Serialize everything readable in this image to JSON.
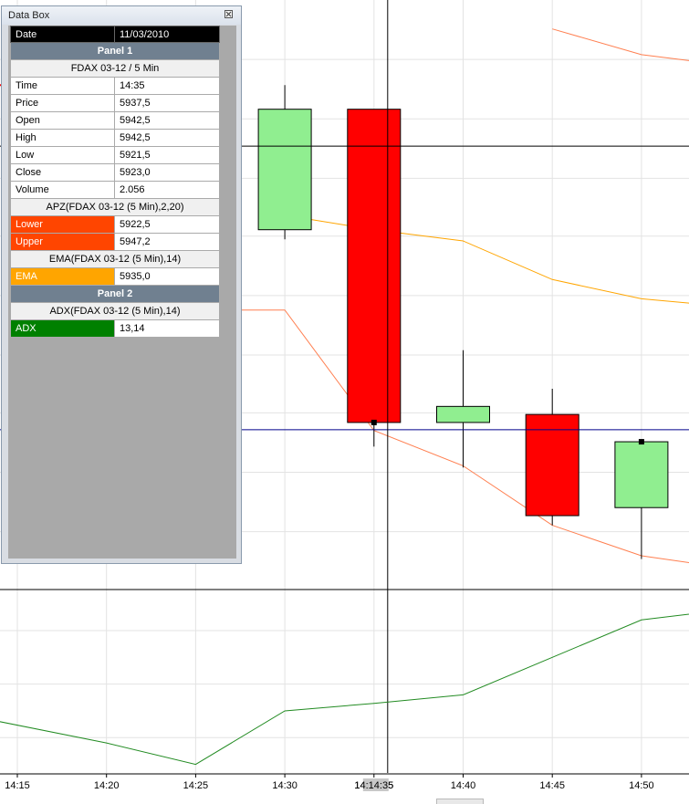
{
  "databox": {
    "title": "Data Box",
    "date_label": "Date",
    "date_value": "11/03/2010",
    "panel1_title": "Panel 1",
    "instrument": "FDAX 03-12 / 5 Min",
    "rows": [
      {
        "label": "Time",
        "value": "14:35"
      },
      {
        "label": "Price",
        "value": "5937,5"
      },
      {
        "label": "Open",
        "value": "5942,5"
      },
      {
        "label": "High",
        "value": "5942,5"
      },
      {
        "label": "Low",
        "value": "5921,5"
      },
      {
        "label": "Close",
        "value": "5923,0"
      },
      {
        "label": "Volume",
        "value": "2.056"
      }
    ],
    "apz_title": "APZ(FDAX 03-12 (5 Min),2,20)",
    "apz_lower_label": "Lower",
    "apz_lower_value": "5922,5",
    "apz_upper_label": "Upper",
    "apz_upper_value": "5947,2",
    "ema_title": "EMA(FDAX 03-12 (5 Min),14)",
    "ema_label": "EMA",
    "ema_value": "5935,0",
    "panel2_title": "Panel 2",
    "adx_title": "ADX(FDAX 03-12 (5 Min),14)",
    "adx_label": "ADX",
    "adx_value": "13,14"
  },
  "colors": {
    "bull": "#90ee90",
    "bear": "#ff0000",
    "apz": "#ff7f50",
    "ema": "#ffa500",
    "adx": "#228b22",
    "crosshair_h": "#00008b",
    "grid": "#e3e3e3"
  },
  "chart_data": {
    "type": "candlestick",
    "times": [
      "14:15",
      "14:20",
      "14:25",
      "14:30",
      "14:35",
      "14:40",
      "14:45",
      "14:50"
    ],
    "time_labels": [
      "14:15",
      "14:20",
      "14:25",
      "14:30",
      "14:14:35",
      "14:40",
      "14:45",
      "14:50"
    ],
    "candles": [
      {
        "time": "14:30",
        "open": 5935.0,
        "high": 5944.0,
        "low": 5934.4,
        "close": 5942.5
      },
      {
        "time": "14:35",
        "open": 5942.5,
        "high": 5942.5,
        "low": 5921.5,
        "close": 5923.0
      },
      {
        "time": "14:40",
        "open": 5923.0,
        "high": 5927.5,
        "low": 5920.2,
        "close": 5924.0
      },
      {
        "time": "14:45",
        "open": 5923.5,
        "high": 5925.1,
        "low": 5916.6,
        "close": 5917.2
      },
      {
        "time": "14:50",
        "open": 5917.7,
        "high": 5918.6,
        "low": 5914.5,
        "close": 5921.8
      }
    ],
    "ema": [
      {
        "time": "14:30",
        "value": 5935.9
      },
      {
        "time": "14:35",
        "value": 5935.0
      },
      {
        "time": "14:40",
        "value": 5934.3
      },
      {
        "time": "14:45",
        "value": 5931.9
      },
      {
        "time": "14:50",
        "value": 5930.7
      },
      {
        "time": "14:55",
        "value": 5930.2
      }
    ],
    "apz_upper": [
      {
        "time": "14:45",
        "value": 5947.5
      },
      {
        "time": "14:50",
        "value": 5945.9
      },
      {
        "time": "14:55",
        "value": 5945.2
      }
    ],
    "apz_lower": [
      {
        "time": "14:27",
        "value": 5930.0
      },
      {
        "time": "14:30",
        "value": 5930.0
      },
      {
        "time": "14:35",
        "value": 5922.5
      },
      {
        "time": "14:40",
        "value": 5920.3
      },
      {
        "time": "14:45",
        "value": 5916.6
      },
      {
        "time": "14:50",
        "value": 5914.7
      },
      {
        "time": "14:55",
        "value": 5913.9
      }
    ],
    "adx": [
      {
        "time": "14:14",
        "value": 12.8
      },
      {
        "time": "14:20",
        "value": 12.4
      },
      {
        "time": "14:25",
        "value": 12.0
      },
      {
        "time": "14:30",
        "value": 13.0
      },
      {
        "time": "14:35",
        "value": 13.14
      },
      {
        "time": "14:40",
        "value": 13.3
      },
      {
        "time": "14:45",
        "value": 14.0
      },
      {
        "time": "14:50",
        "value": 14.7
      },
      {
        "time": "14:55",
        "value": 14.9
      }
    ],
    "crosshair": {
      "time": "14:35",
      "price": 5923.0
    },
    "price_ylim": [
      5912.6,
      5949.3
    ],
    "adx_ylim": [
      11.84,
      15.25
    ]
  }
}
